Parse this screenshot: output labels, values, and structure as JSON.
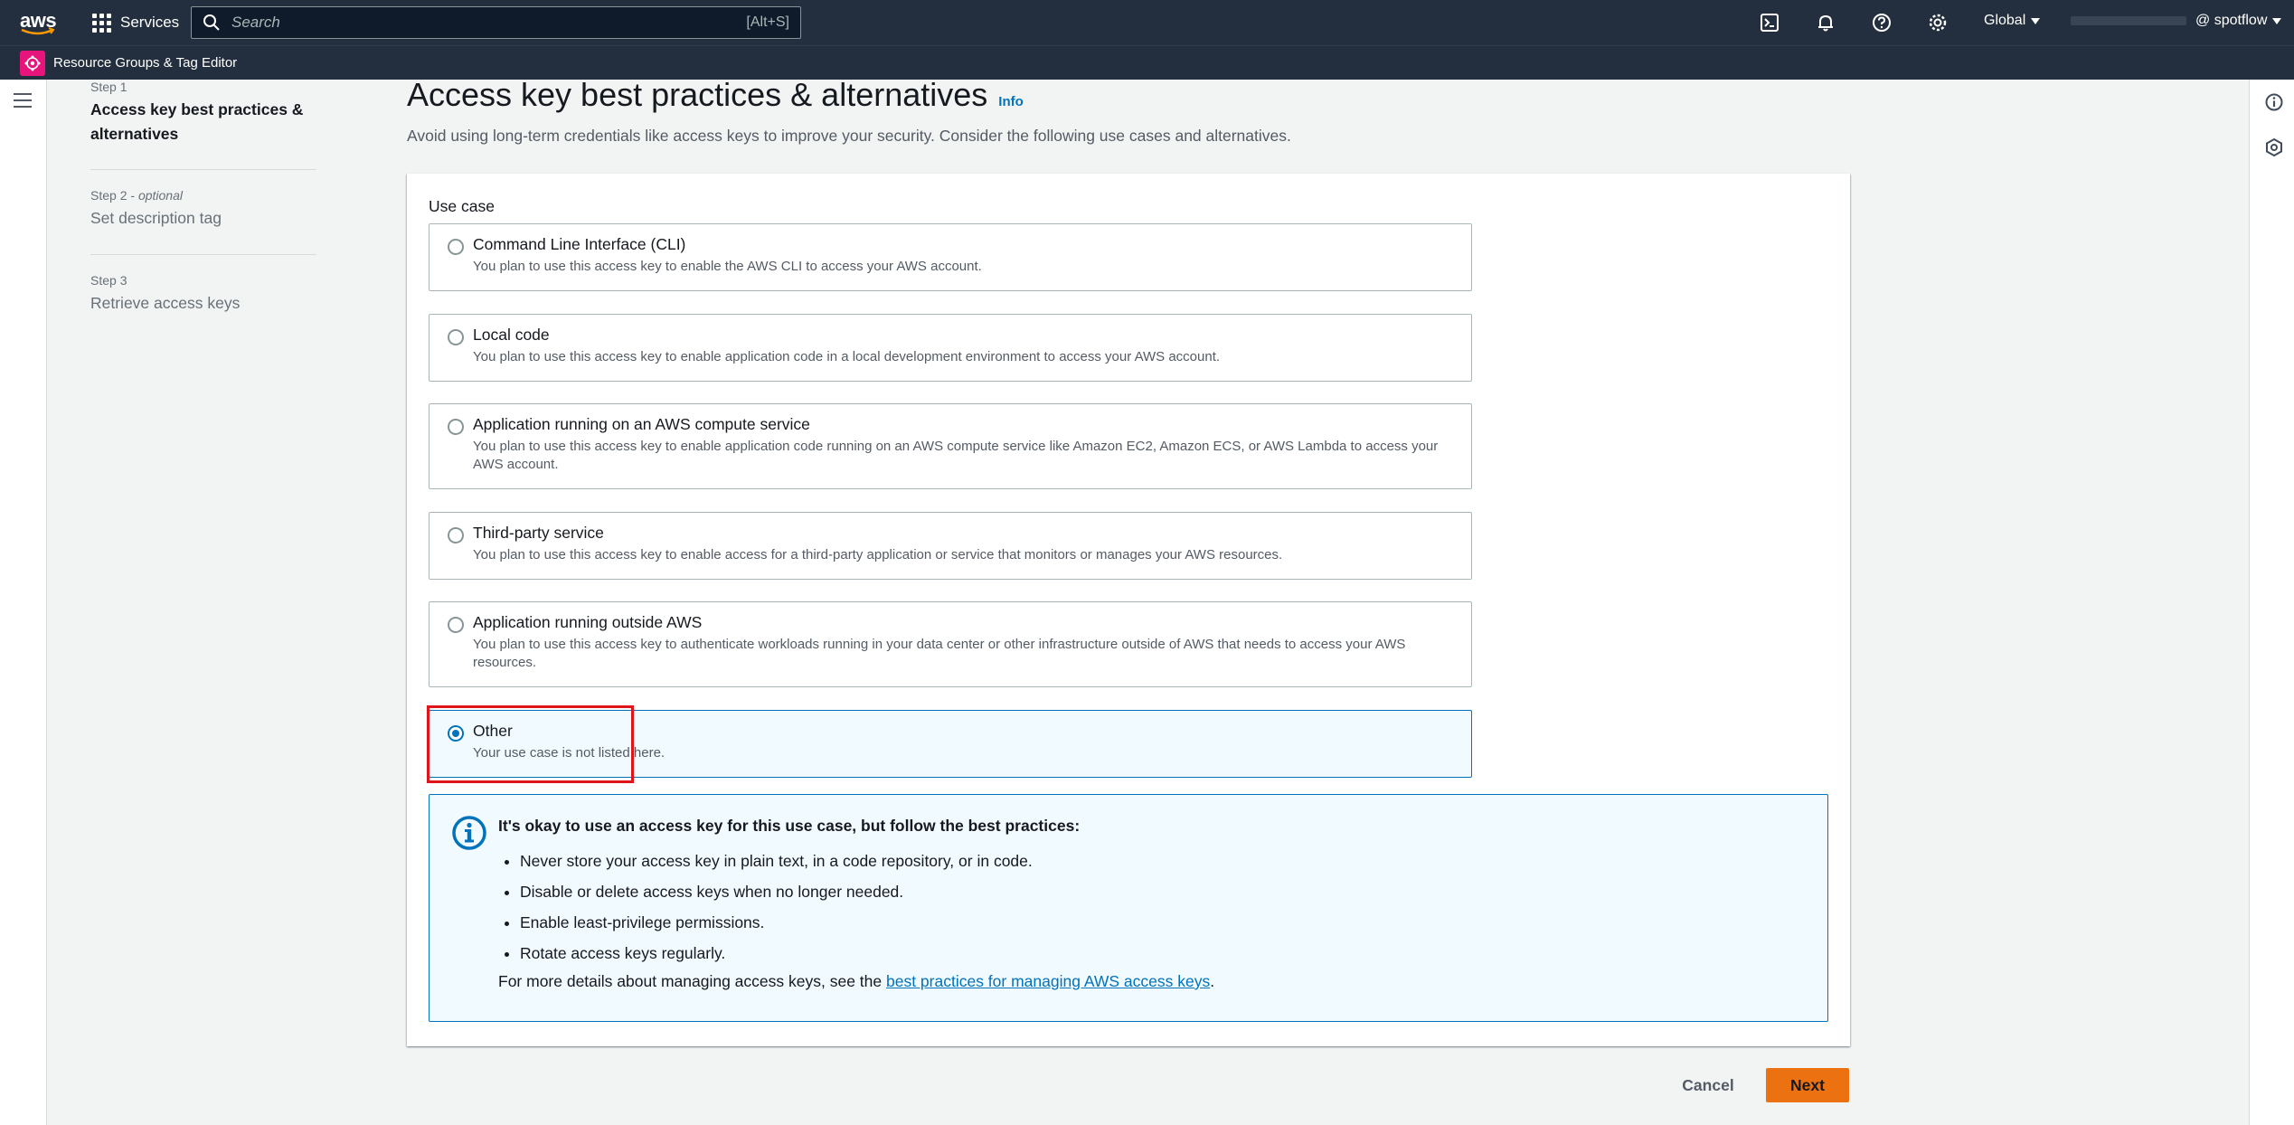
{
  "topnav": {
    "logo_text": "aws",
    "services_label": "Services",
    "search_placeholder": "Search",
    "search_shortcut": "[Alt+S]",
    "region": "Global",
    "account_suffix": "@ spotflow"
  },
  "subnav": {
    "service_name": "Resource Groups & Tag Editor"
  },
  "steps": [
    {
      "number": "Step 1",
      "title": "Access key best practices & alternatives"
    },
    {
      "number": "Step 2",
      "optional": "optional",
      "title": "Set description tag"
    },
    {
      "number": "Step 3",
      "title": "Retrieve access keys"
    }
  ],
  "page": {
    "title": "Access key best practices & alternatives",
    "info_label": "Info",
    "description": "Avoid using long-term credentials like access keys to improve your security. Consider the following use cases and alternatives."
  },
  "use_case": {
    "label": "Use case",
    "selected": "Other",
    "options": [
      {
        "title": "Command Line Interface (CLI)",
        "description": "You plan to use this access key to enable the AWS CLI to access your AWS account."
      },
      {
        "title": "Local code",
        "description": "You plan to use this access key to enable application code in a local development environment to access your AWS account."
      },
      {
        "title": "Application running on an AWS compute service",
        "description": "You plan to use this access key to enable application code running on an AWS compute service like Amazon EC2, Amazon ECS, or AWS Lambda to access your AWS account."
      },
      {
        "title": "Third-party service",
        "description": "You plan to use this access key to enable access for a third-party application or service that monitors or manages your AWS resources."
      },
      {
        "title": "Application running outside AWS",
        "description": "You plan to use this access key to authenticate workloads running in your data center or other infrastructure outside of AWS that needs to access your AWS resources."
      },
      {
        "title": "Other",
        "description": "Your use case is not listed here."
      }
    ]
  },
  "alert": {
    "title": "It's okay to use an access key for this use case, but follow the best practices:",
    "items": [
      "Never store your access key in plain text, in a code repository, or in code.",
      "Disable or delete access keys when no longer needed.",
      "Enable least-privilege permissions.",
      "Rotate access keys regularly."
    ],
    "footer_prefix": "For more details about managing access keys, see the ",
    "footer_link": "best practices for managing AWS access keys",
    "footer_suffix": "."
  },
  "actions": {
    "cancel": "Cancel",
    "next": "Next"
  },
  "colors": {
    "nav_bg": "#232f3e",
    "accent_blue": "#0073bb",
    "primary_orange": "#ec7211",
    "highlight_red": "#e0141b",
    "service_pink": "#e7157b"
  }
}
